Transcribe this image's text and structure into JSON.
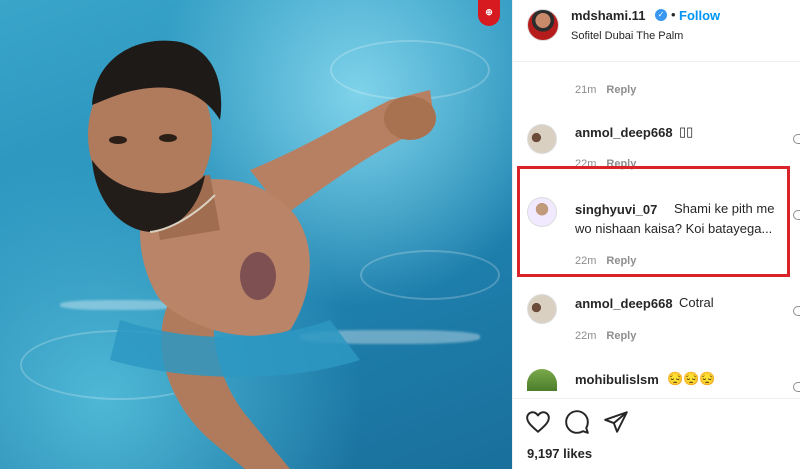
{
  "header": {
    "username": "mdshami.11",
    "verified_mark": "✓",
    "separator": "•",
    "follow_label": "Follow",
    "location": "Sofitel Dubai The Palm"
  },
  "photo": {
    "badge_text": "⊕"
  },
  "comments": [
    {
      "username": "",
      "text": "",
      "time": "21m",
      "reply_label": "Reply"
    },
    {
      "username": "anmol_deep668",
      "text": "▯▯",
      "time": "22m",
      "reply_label": "Reply"
    },
    {
      "username": "singhyuvi_07",
      "text": "Shami ke pith me",
      "text_line2": "wo nishaan kaisa? Koi batayega...",
      "time": "22m",
      "reply_label": "Reply"
    },
    {
      "username": "anmol_deep668",
      "text": "Cotral",
      "time": "22m",
      "reply_label": "Reply"
    },
    {
      "username": "mohibulislsm",
      "text": "😔😔😔",
      "time": "",
      "reply_label": ""
    }
  ],
  "actions": {
    "like_icon": "heart-icon",
    "comment_icon": "comment-icon",
    "share_icon": "share-icon",
    "likes": "9,197 likes"
  },
  "colors": {
    "highlight": "#d8232a",
    "follow": "#0095f6",
    "verified": "#3897f0"
  }
}
